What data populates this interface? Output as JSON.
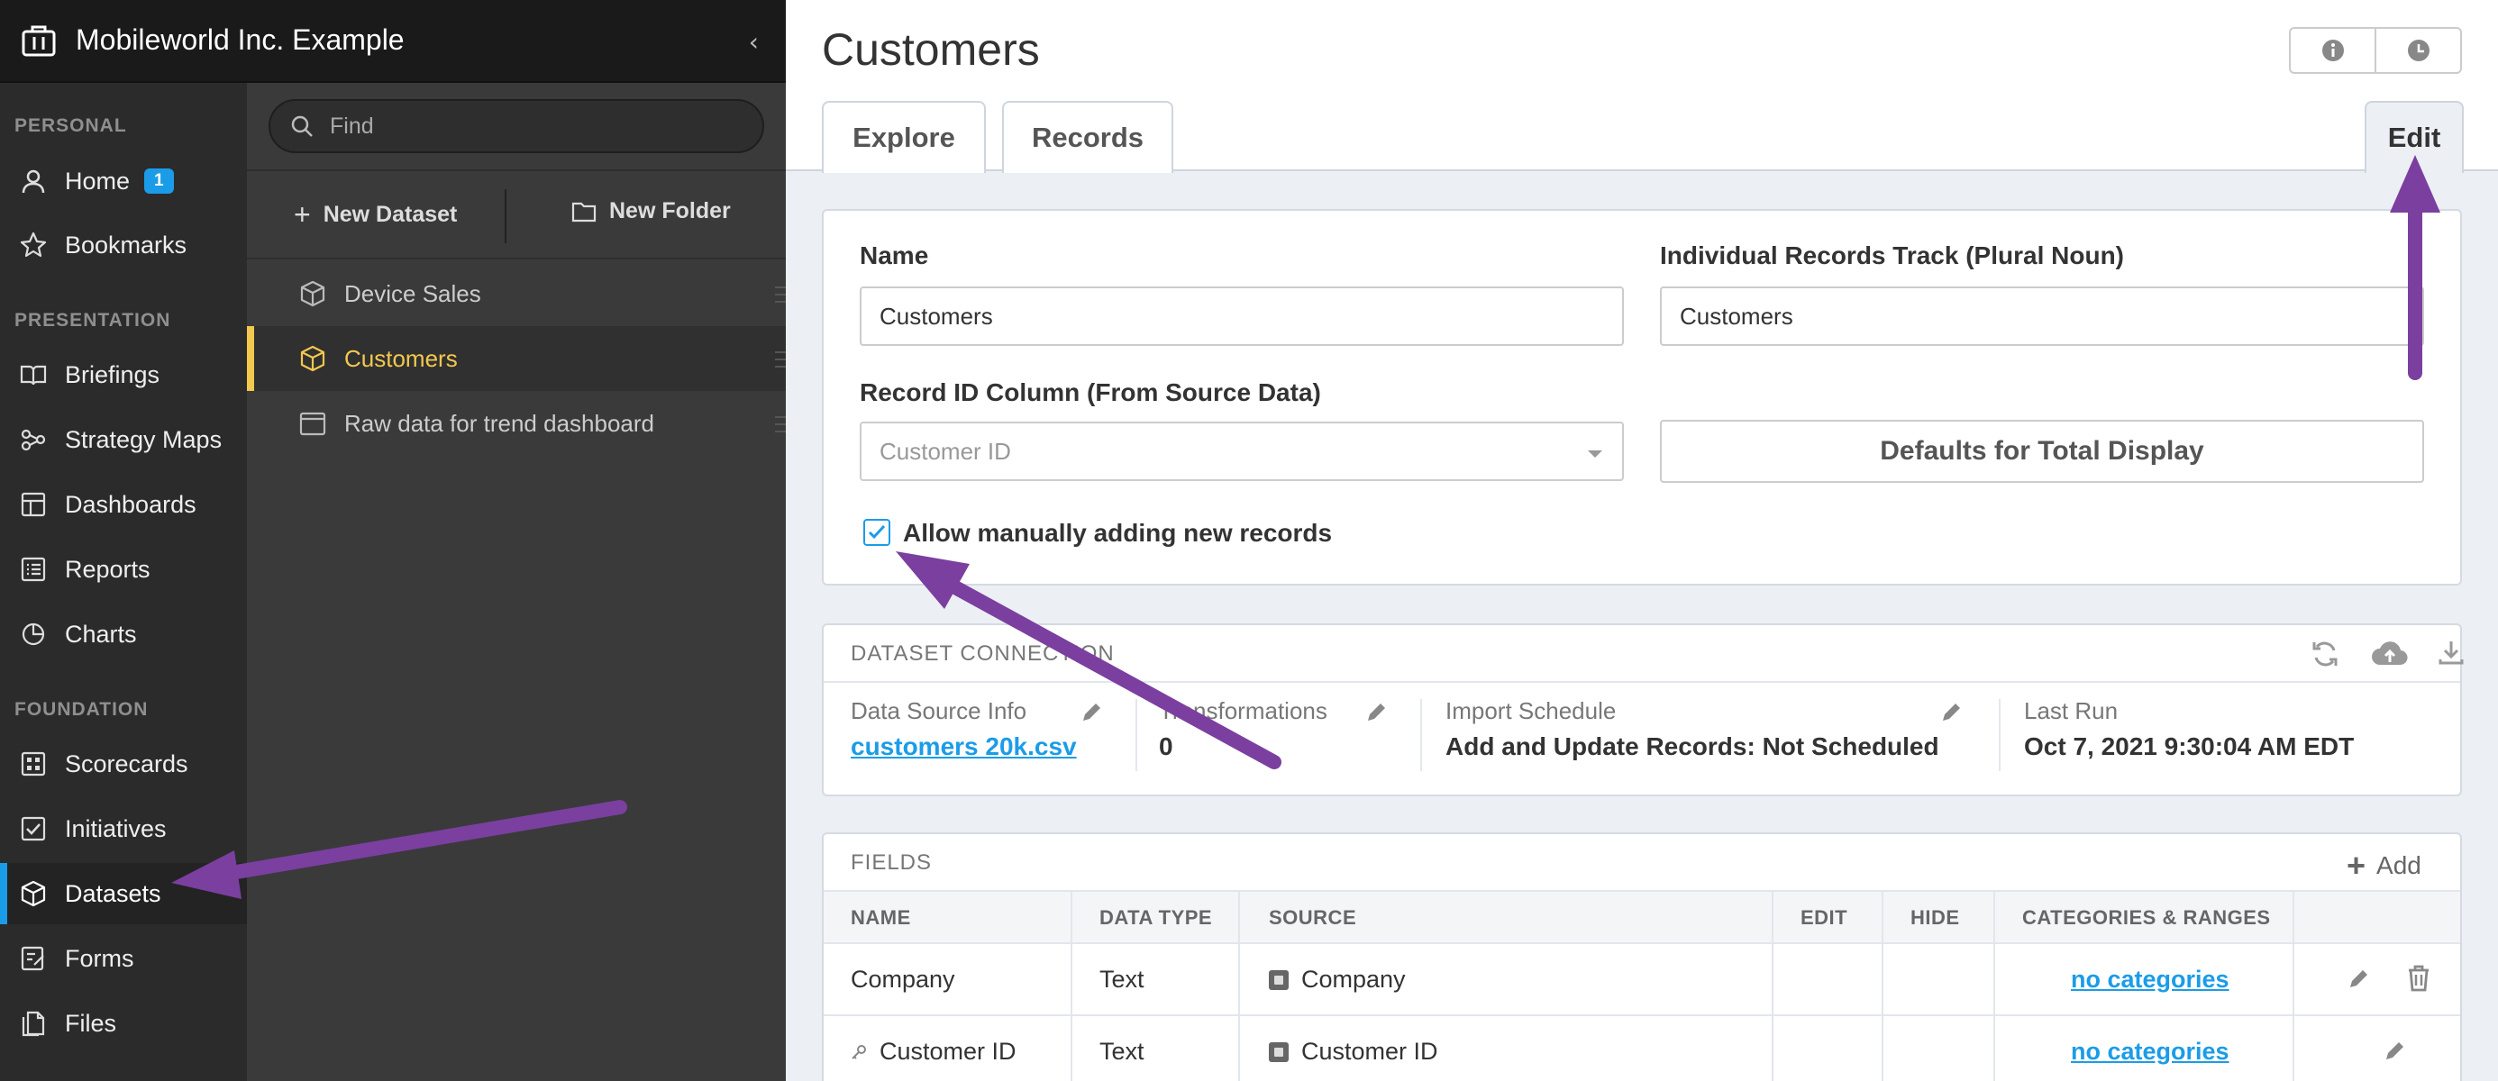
{
  "app": {
    "org_title": "Mobileworld Inc. Example",
    "collapse_icon": "chevron-left-icon"
  },
  "nav": {
    "sections": {
      "personal": "PERSONAL",
      "presentation": "PRESENTATION",
      "foundation": "FOUNDATION"
    },
    "items": [
      {
        "label": "Home",
        "icon": "person-icon",
        "badge": "1"
      },
      {
        "label": "Bookmarks",
        "icon": "star-icon"
      },
      {
        "label": "Briefings",
        "icon": "book-icon"
      },
      {
        "label": "Strategy Maps",
        "icon": "strategy-map-icon"
      },
      {
        "label": "Dashboards",
        "icon": "dashboard-icon"
      },
      {
        "label": "Reports",
        "icon": "report-icon"
      },
      {
        "label": "Charts",
        "icon": "pie-chart-icon"
      },
      {
        "label": "Scorecards",
        "icon": "scorecard-icon"
      },
      {
        "label": "Initiatives",
        "icon": "checkbox-icon"
      },
      {
        "label": "Datasets",
        "icon": "cube-icon",
        "active": true
      },
      {
        "label": "Forms",
        "icon": "form-icon"
      },
      {
        "label": "Files",
        "icon": "file-icon"
      }
    ]
  },
  "panel": {
    "search_placeholder": "Find",
    "new_dataset": "New Dataset",
    "new_folder": "New Folder",
    "items": [
      {
        "label": "Device Sales",
        "type": "dataset"
      },
      {
        "label": "Customers",
        "type": "dataset",
        "selected": true
      },
      {
        "label": "Raw data for trend dashboard",
        "type": "folder"
      }
    ]
  },
  "main": {
    "title": "Customers",
    "tabs": {
      "explore": "Explore",
      "records": "Records",
      "edit": "Edit"
    },
    "form": {
      "name_label": "Name",
      "name_value": "Customers",
      "plural_label": "Individual Records Track (Plural Noun)",
      "plural_value": "Customers",
      "record_id_label": "Record ID Column (From Source Data)",
      "record_id_value": "Customer ID",
      "defaults_button": "Defaults for Total Display",
      "allow_manual_label": "Allow manually adding new records",
      "allow_manual_checked": true
    },
    "connection": {
      "title": "DATASET CONNECTION",
      "data_source_label": "Data Source Info",
      "data_source_value": "customers 20k.csv",
      "transformations_label": "Transformations",
      "transformations_value": "0",
      "import_schedule_label": "Import Schedule",
      "import_schedule_value": "Add and Update Records: Not Scheduled",
      "last_run_label": "Last Run",
      "last_run_value": "Oct 7, 2021 9:30:04 AM EDT"
    },
    "fields": {
      "title": "FIELDS",
      "add_label": "Add",
      "columns": [
        "NAME",
        "DATA TYPE",
        "SOURCE",
        "EDIT",
        "HIDE",
        "CATEGORIES & RANGES"
      ],
      "rows": [
        {
          "name": "Company",
          "data_type": "Text",
          "source": "Company",
          "categories": "no categories",
          "key": false
        },
        {
          "name": "Customer ID",
          "data_type": "Text",
          "source": "Customer ID",
          "categories": "no categories",
          "key": true
        }
      ]
    }
  },
  "colors": {
    "accent": "#1b9ce8",
    "selection": "#f3c84e",
    "annotation_arrow": "#7b3fa0"
  }
}
